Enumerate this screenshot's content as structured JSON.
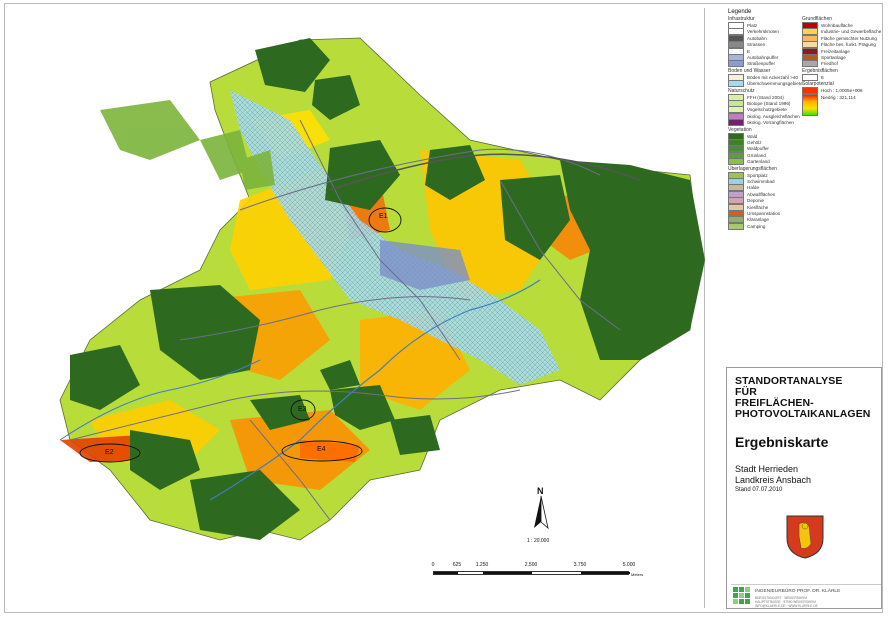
{
  "map": {
    "labels": [
      "E1",
      "E2",
      "E3",
      "E4"
    ],
    "scale_text": "1 : 20.000",
    "north_label": "N",
    "scalebar": {
      "ticks": [
        "0",
        "625",
        "1.250",
        "2.500",
        "3.750",
        "5.000"
      ],
      "unit": "Meters"
    }
  },
  "legend": {
    "title": "Legende",
    "left_sections": [
      {
        "heading": "Infrastruktur",
        "items": [
          {
            "label": "Platz",
            "color": "#ffffff"
          },
          {
            "label": "Verkehrsknoten",
            "color": "#ffffff"
          },
          {
            "label": "Autobahn",
            "color": "#555555"
          },
          {
            "label": "Strassen",
            "color": "#888888"
          },
          {
            "label": "E",
            "color": "#ffffff"
          },
          {
            "label": "Autobahnpuffer",
            "color": "#aab4d8"
          },
          {
            "label": "Straßenpuffer",
            "color": "#8a9ed2"
          }
        ]
      },
      {
        "heading": "Boden und Wasser",
        "items": [
          {
            "label": "Böden mit Ackerzahl >40",
            "color": "#f6f0d6"
          },
          {
            "label": "Überschwemmungsgebiete",
            "color": "#a8d8ee"
          }
        ]
      },
      {
        "heading": "Naturschutz",
        "items": [
          {
            "label": "FFH (Stand 2004)",
            "color": "#d8f0a0"
          },
          {
            "label": "Biotope (Stand 1996)",
            "color": "#c8e890"
          },
          {
            "label": "Vogelschutzgebiete",
            "color": "#e0f0c0"
          },
          {
            "label": "ökolog. Ausgleichsflächen",
            "color": "#c080c0"
          },
          {
            "label": "ökolog. Vorrangflächen",
            "color": "#702070"
          }
        ]
      },
      {
        "heading": "Vegetation",
        "items": [
          {
            "label": "Wald",
            "color": "#2e6b22"
          },
          {
            "label": "Gehölz",
            "color": "#3f7f2e"
          },
          {
            "label": "Waldpuffer",
            "color": "#4e8a3a"
          },
          {
            "label": "Grünland",
            "color": "#5e9c3e"
          },
          {
            "label": "Gartenland",
            "color": "#8bbf4a"
          }
        ]
      },
      {
        "heading": "Überlagerungsflächen",
        "items": [
          {
            "label": "Sportplatz",
            "color": "#a0c060"
          },
          {
            "label": "Schwimmbad",
            "color": "#9ad0e8"
          },
          {
            "label": "Halde",
            "color": "#c8b8a0"
          },
          {
            "label": "Abwallflächen",
            "color": "#c0a0c8"
          },
          {
            "label": "Deponie",
            "color": "#d8a0b0"
          },
          {
            "label": "Kiesfläche",
            "color": "#e0c8a0"
          },
          {
            "label": "Umspannstation",
            "color": "#d06020"
          },
          {
            "label": "Kläranlage",
            "color": "#90b070"
          },
          {
            "label": "Camping",
            "color": "#a8c870"
          }
        ]
      }
    ],
    "right_sections": [
      {
        "heading": "Grundflächen",
        "items": [
          {
            "label": "Wohnbaufläche",
            "color": "#c00000"
          },
          {
            "label": "Industrie- und Gewerbefläche",
            "color": "#ffd24a"
          },
          {
            "label": "Fläche gemischter Nutzung",
            "color": "#f4b860"
          },
          {
            "label": "Fläche bes. funkt. Prägung",
            "color": "#f6d9a8"
          },
          {
            "label": "Freizeitanlage",
            "color": "#8b1a1a"
          },
          {
            "label": "Sportanlage",
            "color": "#b85a20"
          },
          {
            "label": "Friedhof",
            "color": "#a8a8a8"
          }
        ]
      },
      {
        "heading": "Ergebnisflächen",
        "items": [
          {
            "label": "E",
            "color": "#ffffff"
          }
        ]
      },
      {
        "heading": "Solarpotenzial",
        "items": [
          {
            "label": "Hoch : 1,0005e+006",
            "color": "#ff3000"
          },
          {
            "label": "Niedrig : 321,114",
            "color": "#40e000"
          }
        ]
      }
    ]
  },
  "titlebox": {
    "title_lines": [
      "STANDORTANALYSE",
      "FÜR",
      "FREIFLÄCHEN-",
      "PHOTOVOLTAIKANLAGEN"
    ],
    "subtitle": "Ergebniskarte",
    "city": "Stadt Herrieden",
    "district": "Landkreis Ansbach",
    "date": "Stand 07.07.2010",
    "office_name": "INGENIEURBÜRO PROF. DR. KLÄRLE",
    "office_lines": [
      "BÜROSTANDORT · WEIKERSHEIM",
      "HAUPTSTRASSE · 97990 WEIKERSHEIM",
      "INFO@KLAERLE.DE · WWW.KLAERLE.DE"
    ]
  }
}
